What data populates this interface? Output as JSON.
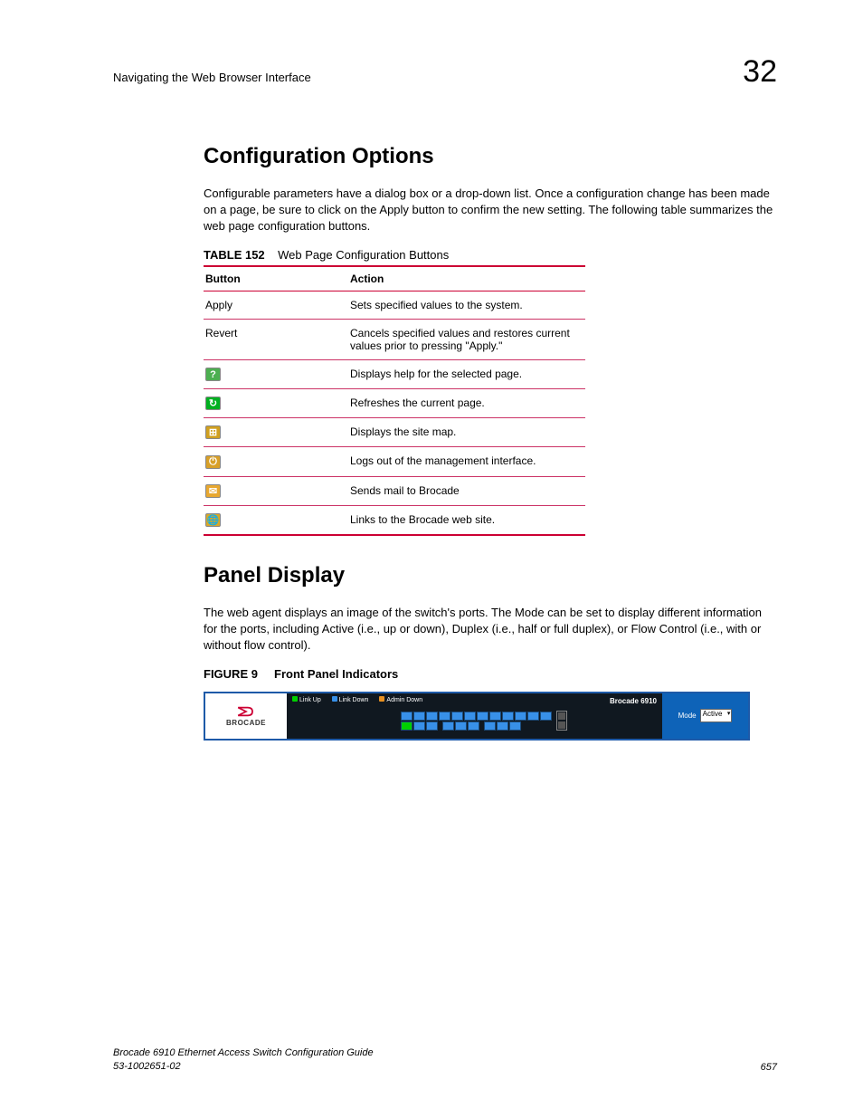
{
  "header": {
    "breadcrumb": "Navigating the Web Browser Interface",
    "chapter": "32"
  },
  "section1": {
    "title": "Configuration Options",
    "paragraph": "Configurable parameters have a dialog box or a drop-down list. Once a configuration change has been made on a page, be sure to click on the Apply button to confirm the new setting. The following table summarizes the web page configuration buttons.",
    "table_label": "TABLE 152",
    "table_title": "Web Page Configuration Buttons",
    "col1": "Button",
    "col2": "Action",
    "rows": [
      {
        "button": "Apply",
        "action": "Sets specified values to the system."
      },
      {
        "button": "Revert",
        "action": "Cancels specified values and restores current values prior to pressing \"Apply.\""
      },
      {
        "button": "",
        "action": "Displays help for the selected page."
      },
      {
        "button": "",
        "action": "Refreshes the current page."
      },
      {
        "button": "",
        "action": "Displays the site map."
      },
      {
        "button": "",
        "action": "Logs out of the management interface."
      },
      {
        "button": "",
        "action": "Sends mail to Brocade"
      },
      {
        "button": "",
        "action": "Links to the Brocade web site."
      }
    ]
  },
  "section2": {
    "title": "Panel Display",
    "paragraph": "The web agent displays an image of the switch's ports. The Mode can be set to display different information for the ports, including Active (i.e., up or down), Duplex (i.e., half or full duplex), or Flow Control (i.e., with or without flow control).",
    "figure_label": "FIGURE 9",
    "figure_title": "Front Panel Indicators",
    "panel": {
      "brand": "BROCADE",
      "legend": {
        "up": "Link Up",
        "down": "Link Down",
        "admin": "Admin Down"
      },
      "model": "Brocade 6910",
      "mode_label": "Mode",
      "mode_value": "Active"
    }
  },
  "footer": {
    "title": "Brocade 6910 Ethernet Access Switch Configuration Guide",
    "docnum": "53-1002651-02",
    "page": "657"
  }
}
